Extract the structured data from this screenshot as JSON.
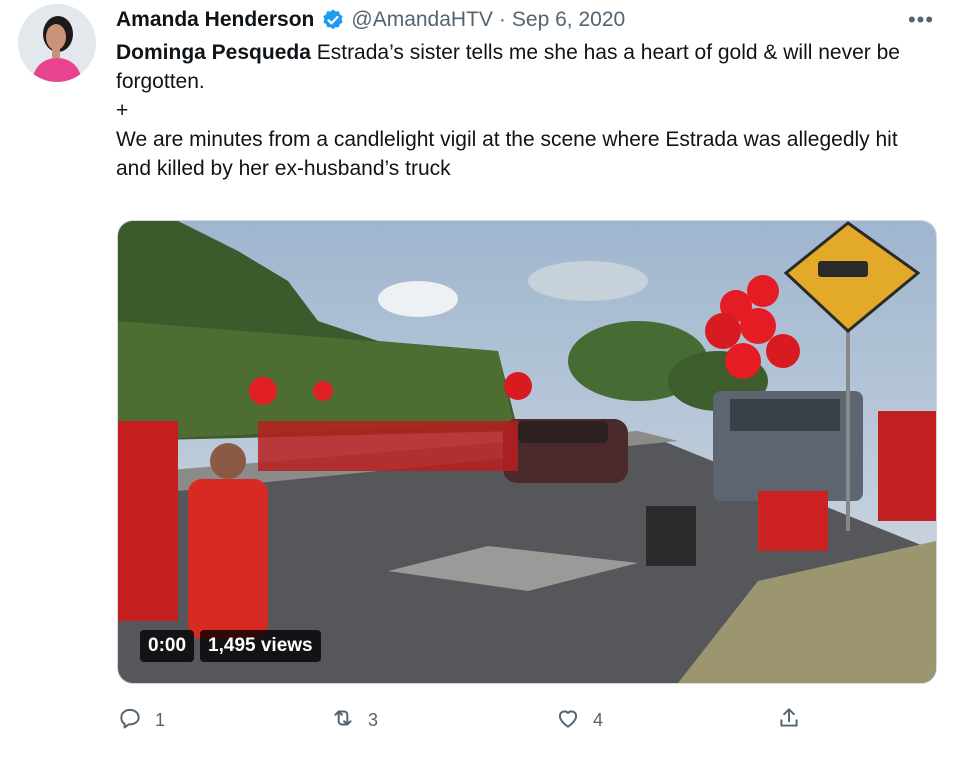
{
  "tweet": {
    "author_name": "Amanda Henderson",
    "handle": "@AmandaHTV",
    "separator": "·",
    "date": "Sep 6, 2020",
    "more_label": "•••",
    "text_mention": "Dominga Pesqueda",
    "text_line1_rest": " Estrada’s sister tells me she has a heart of gold & will never be forgotten.",
    "text_plus": "+",
    "text_line3": "We are minutes from a candlelight vigil at the scene where Estrada was allegedly hit and killed by her ex-husband’s truck"
  },
  "video": {
    "time": "0:00",
    "views": "1,495 views"
  },
  "actions": {
    "reply_count": "1",
    "retweet_count": "3",
    "like_count": "4"
  },
  "colors": {
    "verified_badge": "#1d9bf0",
    "secondary_text": "#536471",
    "primary_text": "#0f1419"
  },
  "icons": [
    "verified-badge-icon",
    "more-icon",
    "reply-icon",
    "retweet-icon",
    "like-icon",
    "share-icon"
  ]
}
